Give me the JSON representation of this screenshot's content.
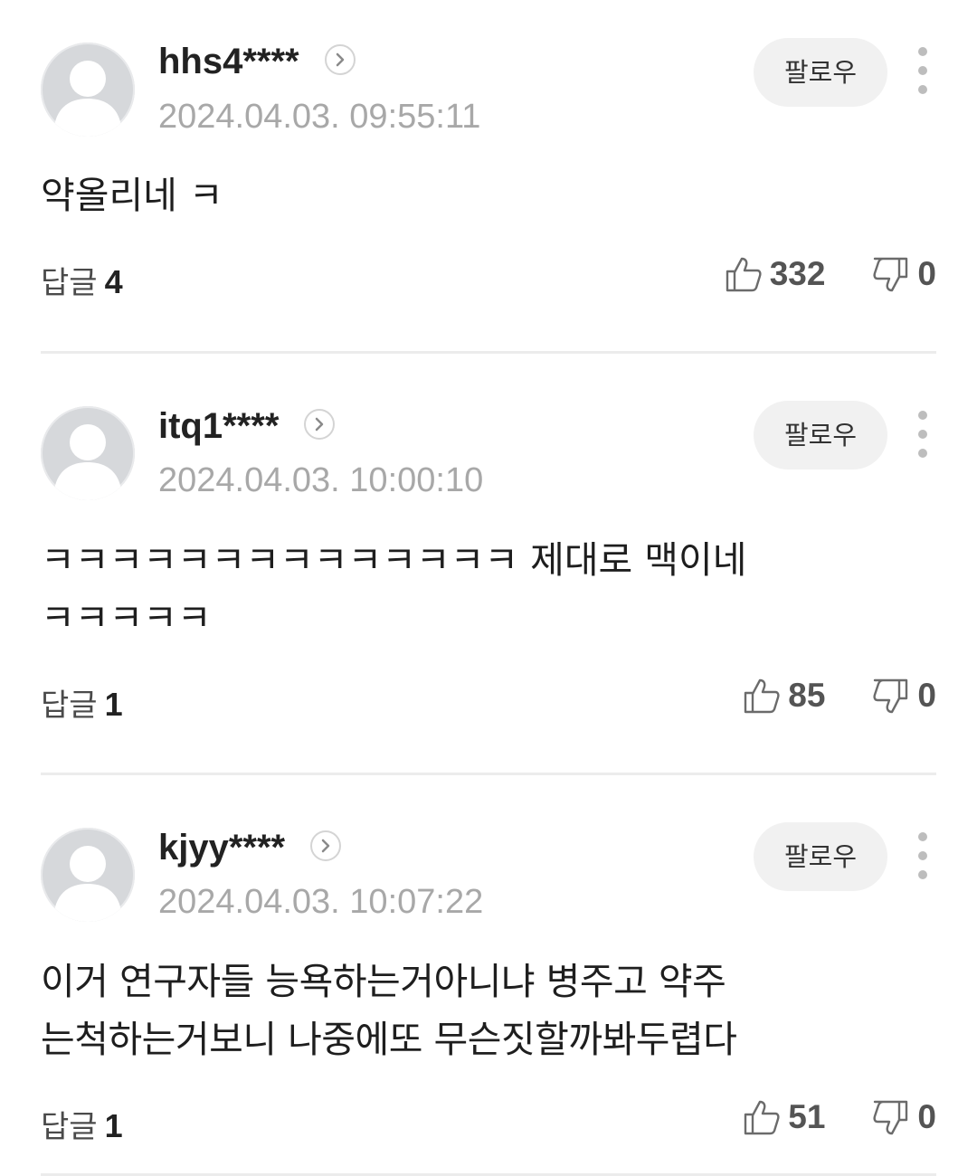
{
  "comments": [
    {
      "username": "hhs4****",
      "timestamp": "2024.04.03. 09:55:11",
      "follow_label": "팔로우",
      "content": "약올리네 ㅋ",
      "reply_label": "답글",
      "reply_count": "4",
      "likes": "332",
      "dislikes": "0"
    },
    {
      "username": "itq1****",
      "timestamp": "2024.04.03. 10:00:10",
      "follow_label": "팔로우",
      "content": "ㅋㅋㅋㅋㅋㅋㅋㅋㅋㅋㅋㅋㅋㅋ 제대로 맥이네\nㅋㅋㅋㅋㅋ",
      "reply_label": "답글",
      "reply_count": "1",
      "likes": "85",
      "dislikes": "0"
    },
    {
      "username": "kjyy****",
      "timestamp": "2024.04.03. 10:07:22",
      "follow_label": "팔로우",
      "content": "이거 연구자들 능욕하는거아니냐 병주고 약주\n는척하는거보니 나중에또 무슨짓할까봐두렵다",
      "reply_label": "답글",
      "reply_count": "1",
      "likes": "51",
      "dislikes": "0"
    }
  ],
  "icons": {
    "avatar": "default-avatar-icon",
    "profile": "chevron-right-icon",
    "more": "more-vertical-icon",
    "like": "thumbs-up-icon",
    "dislike": "thumbs-down-icon"
  },
  "colors": {
    "follow_bg": "#f1f1f1",
    "timestamp": "#a8a8a8",
    "divider": "#ececec"
  }
}
